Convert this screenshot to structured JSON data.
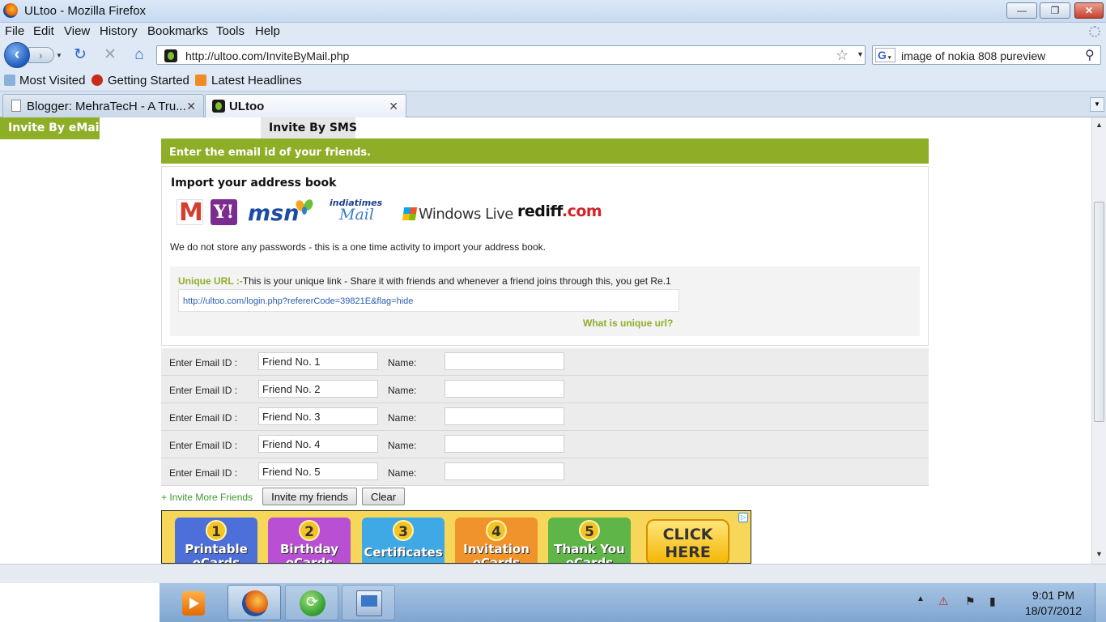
{
  "window": {
    "title": "ULtoo - Mozilla Firefox"
  },
  "menu": [
    "File",
    "Edit",
    "View",
    "History",
    "Bookmarks",
    "Tools",
    "Help"
  ],
  "navbar": {
    "url": "http://ultoo.com/InviteByMail.php",
    "search_engine": "G",
    "search_value": "image of nokia 808 pureview"
  },
  "bookmarks": [
    "Most Visited",
    "Getting Started",
    "Latest Headlines"
  ],
  "tabs": [
    {
      "title": "Blogger: MehraTecH - A Tru..."
    },
    {
      "title": "ULtoo"
    }
  ],
  "page": {
    "invite_tabs": [
      "Invite By eMail",
      "Invite By SMS"
    ],
    "instruction": "Enter the email id of your friends.",
    "import_title": "Import your address book",
    "providers": {
      "gmail": "M",
      "yahoo": "Y!",
      "msn": "msn",
      "indiatimes_top": "indiatimes",
      "indiatimes_mail": "Mail",
      "windowslive": "Windows Live",
      "rediff_name": "rediff",
      "rediff_dot": ".com"
    },
    "no_password_note": "We do not store any passwords - this is a one time activity to import your address book.",
    "unique": {
      "label": "Unique URL :-",
      "description": "This is your unique link - Share it with friends and whenever a friend joins through this, you get Re.1",
      "url": "http://ultoo.com/login.php?refererCode=39821E&flag=hide",
      "what_link": "What is unique url?"
    },
    "email_label": "Enter Email ID :",
    "name_label": "Name:",
    "friends": [
      {
        "email": "Friend No. 1",
        "name": ""
      },
      {
        "email": "Friend No. 2",
        "name": ""
      },
      {
        "email": "Friend No. 3",
        "name": ""
      },
      {
        "email": "Friend No. 4",
        "name": ""
      },
      {
        "email": "Friend No. 5",
        "name": ""
      }
    ],
    "invite_more": "+ Invite More Friends",
    "invite_button": "Invite my friends",
    "clear_button": "Clear",
    "banner": {
      "cards": [
        {
          "num": "1",
          "label": "Printable eCards"
        },
        {
          "num": "2",
          "label": "Birthday eCards"
        },
        {
          "num": "3",
          "label": "Certificates"
        },
        {
          "num": "4",
          "label": "Invitation eCards"
        },
        {
          "num": "5",
          "label": "Thank You eCards"
        }
      ],
      "cta": "CLICK HERE"
    }
  },
  "taskbar": {
    "time": "9:01 PM",
    "date": "18/07/2012"
  }
}
